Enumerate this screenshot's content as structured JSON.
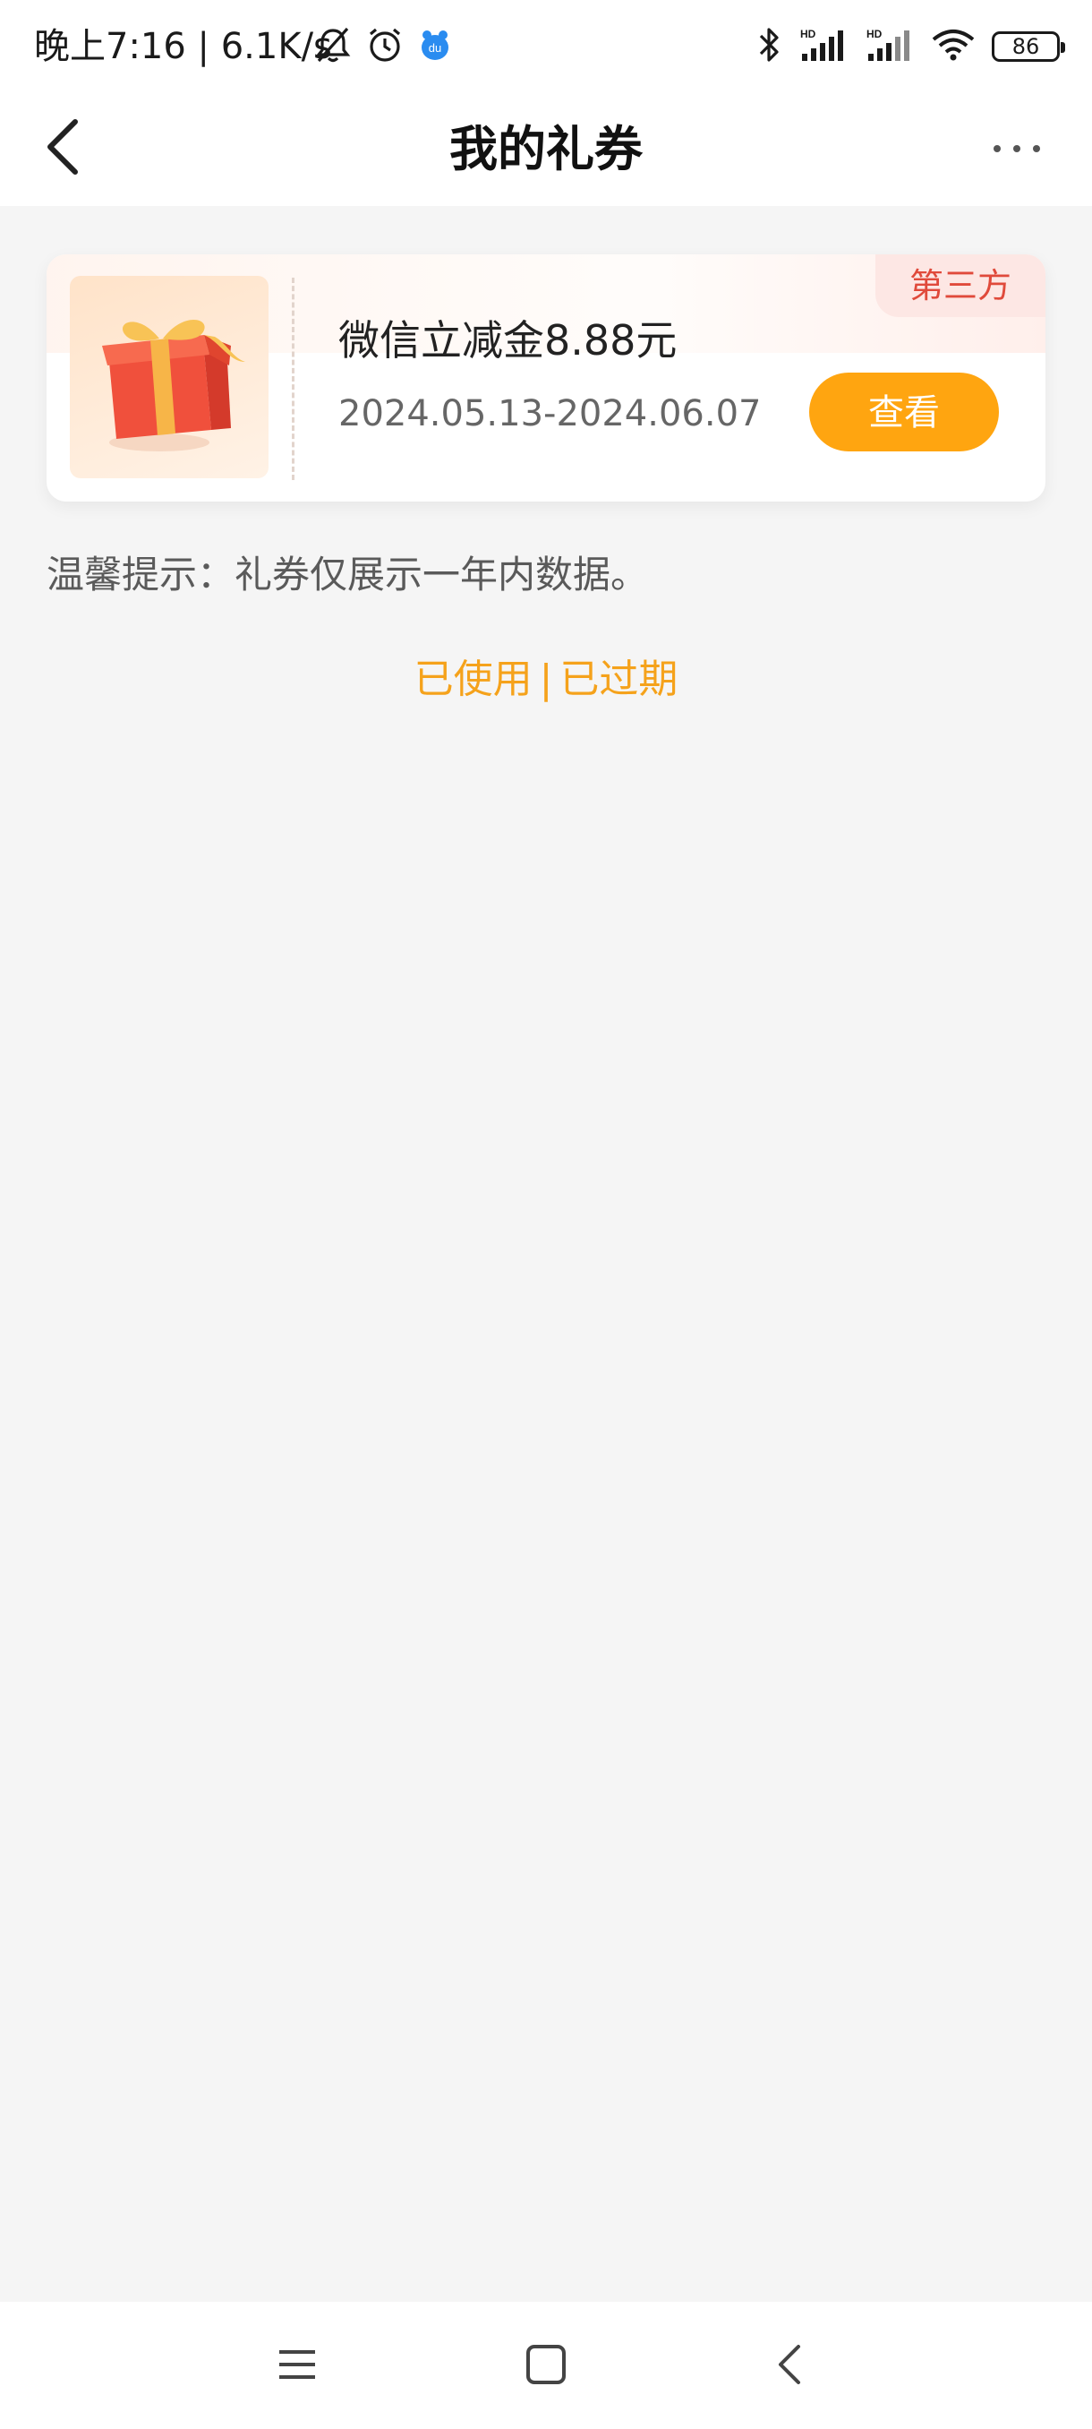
{
  "status_bar": {
    "time": "晚上7:16 | 6.1K/s",
    "battery_level": "86",
    "icons": [
      "bell-off-icon",
      "alarm-icon",
      "app-notification-icon",
      "bluetooth-icon",
      "signal-hd-icon",
      "signal-hd-icon",
      "wifi-icon",
      "battery-icon"
    ]
  },
  "header": {
    "title": "我的礼券",
    "back_icon": "back-arrow-icon",
    "more_icon": "more-dots-icon"
  },
  "coupons": [
    {
      "name": "微信立减金8.88元",
      "date_range": "2024.05.13-2024.06.07",
      "badge": "第三方",
      "action_label": "查看",
      "thumbnail_icon": "gift-box-icon"
    }
  ],
  "tip": "温馨提示：礼券仅展示一年内数据。",
  "history_links": {
    "used": "已使用",
    "separator": "|",
    "expired": "已过期"
  },
  "colors": {
    "accent": "#ffa510",
    "link": "#f5a21b",
    "badge_text": "#e04a3b",
    "badge_bg": "#fde7e4",
    "background": "#f5f5f5"
  },
  "system_nav": {
    "icons": [
      "menu-icon",
      "home-square-icon",
      "back-chevron-icon"
    ]
  }
}
